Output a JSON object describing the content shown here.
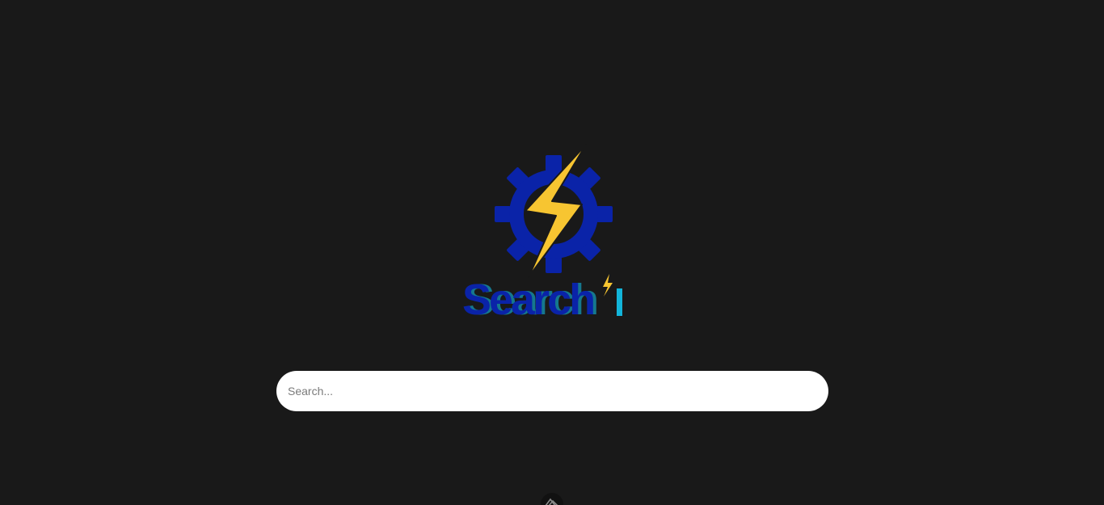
{
  "logo": {
    "wordmark": "Search",
    "icon": "gear-lightning-icon",
    "colors": {
      "gear": "#0a23a8",
      "bolt": "#f7c531",
      "wordmark_primary": "#0a23a8",
      "wordmark_accent": "#12c6ef"
    }
  },
  "search": {
    "placeholder": "Search...",
    "value": ""
  },
  "footer": {
    "icon": "mountain-logo-icon"
  },
  "theme": {
    "background": "#191919"
  }
}
